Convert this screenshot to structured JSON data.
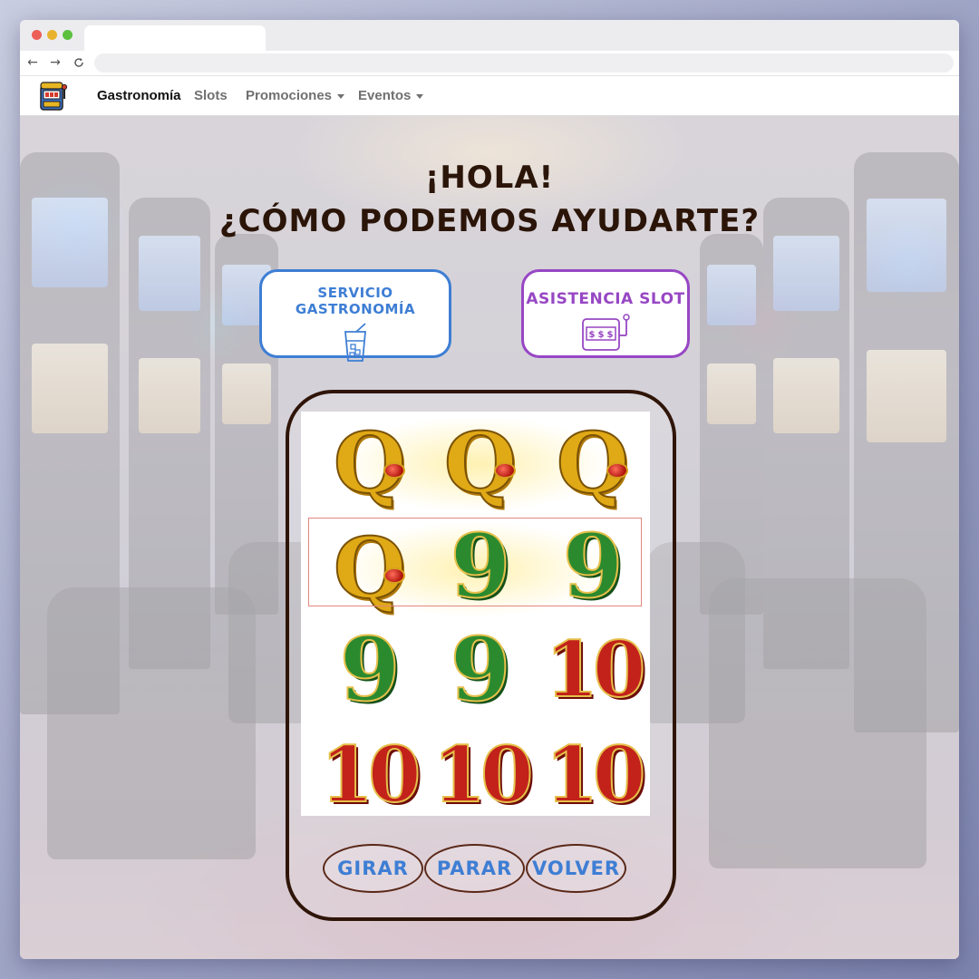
{
  "browser": {
    "tab_title": "",
    "url": "",
    "back_icon": "←",
    "forward_icon": "→",
    "reload_icon": "C"
  },
  "navbar": {
    "logo_icon": "slot-machine-logo",
    "links": [
      {
        "label": "Gastronomía",
        "active": true
      },
      {
        "label": "Slots",
        "active": false
      },
      {
        "label": "Promociones",
        "dropdown": true
      },
      {
        "label": "Eventos",
        "dropdown": true
      }
    ]
  },
  "hero": {
    "line1": "¡HOLA!",
    "line2": "¿CÓMO PODEMOS AYUDARTE?"
  },
  "services": {
    "gastronomia": {
      "label": "SERVICIO GASTRONOMÍA",
      "icon": "drink-cup-icon",
      "color": "#3e7ed4"
    },
    "slot": {
      "label": "ASISTENCIA SLOT",
      "icon": "slot-machine-icon",
      "color": "#9747c4"
    }
  },
  "reels": {
    "rows": [
      [
        "Q",
        "Q",
        "Q"
      ],
      [
        "Q",
        "9",
        "9"
      ],
      [
        "9",
        "9",
        "10"
      ],
      [
        "10",
        "10",
        "10"
      ]
    ],
    "highlighted_row": 2
  },
  "controls": {
    "girar": "GIRAR",
    "parar": "PARAR",
    "volver": "VOLVER"
  },
  "colors": {
    "heading": "#2b1508",
    "frame": "#2f1508",
    "control_text": "#3e7ed4"
  }
}
